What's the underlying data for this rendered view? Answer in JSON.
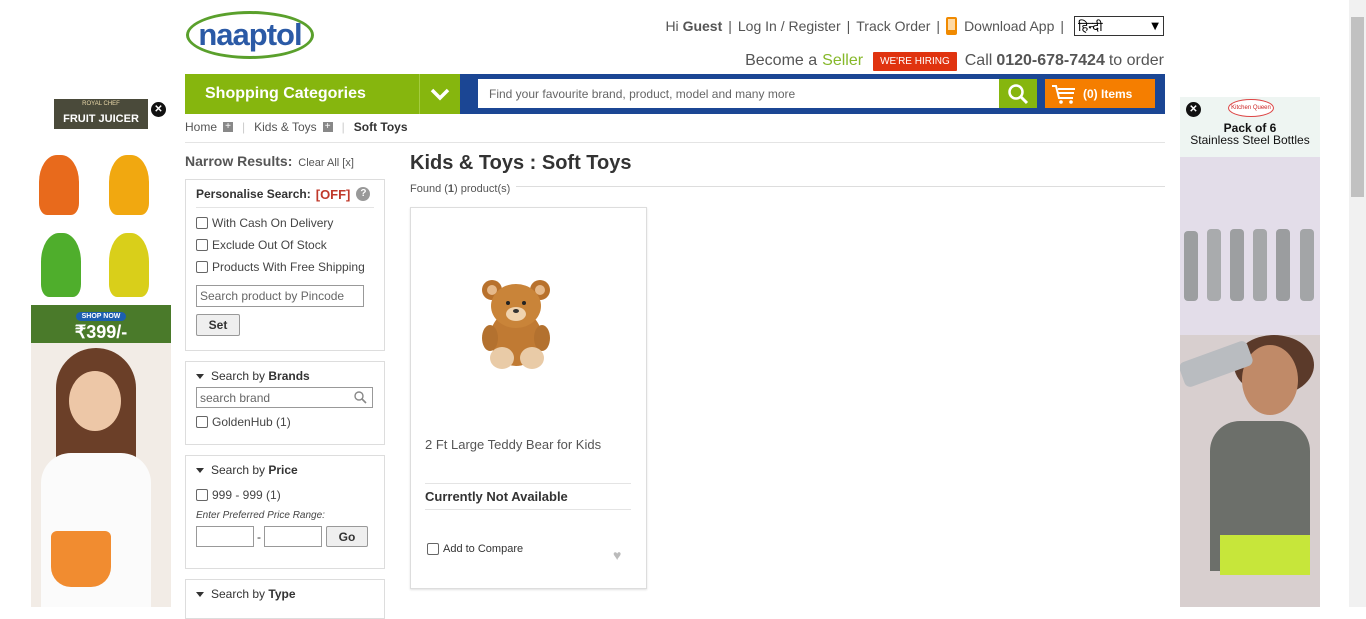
{
  "header": {
    "logo_text": "naaptol",
    "greeting_prefix": "Hi",
    "greeting_name": "Guest",
    "login_link": "Log In / Register",
    "track_order": "Track Order",
    "download_app": "Download App",
    "language_selected": "हिन्दी",
    "become_a": "Become a",
    "seller": "Seller",
    "hiring_badge": "WE'RE HIRING",
    "call_prefix": "Call",
    "phone": "0120-678-7424",
    "call_suffix": "to order"
  },
  "nav": {
    "categories_label": "Shopping Categories",
    "search_placeholder": "Find your favourite brand, product, model and many more",
    "cart_label": "(0) Items"
  },
  "breadcrumb": {
    "home": "Home",
    "category": "Kids & Toys",
    "current": "Soft Toys"
  },
  "sidebar": {
    "narrow_title": "Narrow Results:",
    "clear_all": "Clear All [x]",
    "personalise": {
      "label": "Personalise Search:",
      "state": "[OFF]",
      "options": [
        "With Cash On Delivery",
        "Exclude Out Of Stock",
        "Products With Free Shipping"
      ],
      "pincode_placeholder": "Search product by Pincode",
      "set_button": "Set"
    },
    "brands": {
      "label_prefix": "Search by",
      "label_bold": "Brands",
      "search_placeholder": "search brand",
      "items": [
        "GoldenHub (1)"
      ]
    },
    "price": {
      "label_prefix": "Search by",
      "label_bold": "Price",
      "items": [
        "999 - 999 (1)"
      ],
      "range_label": "Enter Preferred Price Range:",
      "range_sep": "-",
      "go_button": "Go"
    },
    "type": {
      "label_prefix": "Search by",
      "label_bold": "Type"
    }
  },
  "main": {
    "title": "Kids & Toys : Soft Toys",
    "found_prefix": "Found (",
    "found_count": "1",
    "found_suffix": ") product(s)",
    "product": {
      "name": "2 Ft Large Teddy Bear for Kids",
      "availability": "Currently Not Available",
      "compare_label": "Add to Compare"
    }
  },
  "ads": {
    "left_brand": "ROYAL CHEF",
    "left_title": "FRUIT JUICER",
    "left_shop": "SHOP NOW",
    "left_price": "₹399/-",
    "right_brand": "Kitchen Queen",
    "right_line1": "Pack of 6",
    "right_line2": "Stainless Steel Bottles"
  },
  "colors": {
    "nav_blue": "#1b4694",
    "green": "#86b60e",
    "cart_orange": "#f57e00",
    "hiring_red": "#e0330f",
    "off_red": "#c0392b"
  }
}
